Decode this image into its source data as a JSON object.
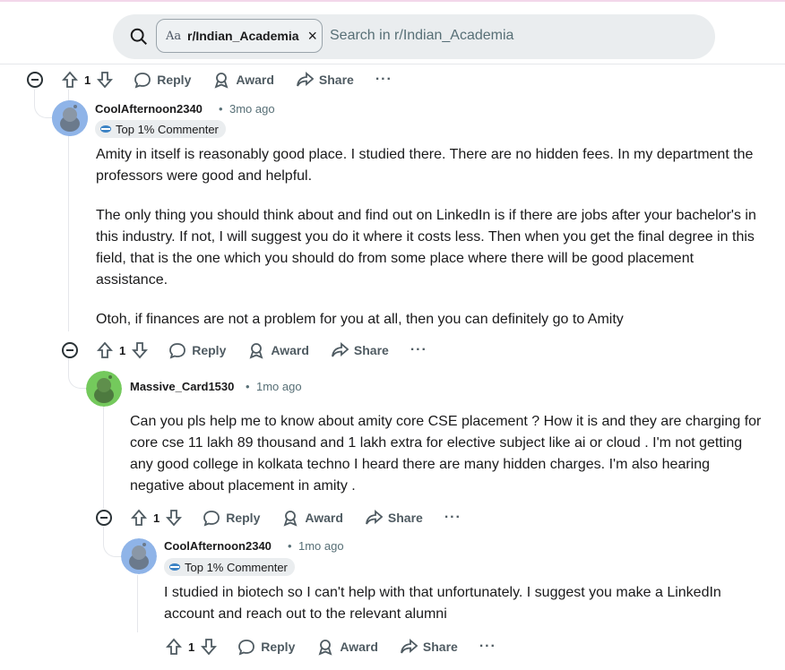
{
  "search": {
    "chip_label": "r/Indian_Academia",
    "chip_prefix": "Aa",
    "chip_close": "×",
    "placeholder": "Search in r/Indian_Academia"
  },
  "colors": {
    "upvote_brand": "#4f5b62",
    "avatar_blue": "#8fb4e8",
    "avatar_green": "#74c95c",
    "thread_line": "#e5e7eb"
  },
  "action_labels": {
    "reply": "Reply",
    "award": "Award",
    "share": "Share",
    "more": "···"
  },
  "comments": [
    {
      "votes": "1"
    },
    {
      "username": "CoolAfternoon2340",
      "time": "3mo ago",
      "badge": "Top 1% Commenter",
      "paragraphs": [
        "Amity in itself is reasonably good place. I studied there. There are no hidden fees. In my department the professors were good and helpful.",
        "The only thing you should think about and find out on LinkedIn is if there are jobs after your bachelor's in this industry. If not, I will suggest you do it where it costs less. Then when you get the final degree in this field, that is the one which you should do from some place where there will be good placement assistance.",
        "Otoh, if finances are not a problem for you at all, then you can definitely go to Amity"
      ],
      "votes": "1"
    },
    {
      "username": "Massive_Card1530",
      "time": "1mo ago",
      "paragraphs": [
        "Can you pls help me to know about amity core CSE placement ? How it is and they are charging for core cse 11 lakh 89 thousand and 1 lakh extra for elective subject like ai or cloud . I'm not getting any good college in kolkata techno I heard there are many hidden charges. I'm also hearing negative about placement in amity ."
      ],
      "votes": "1"
    },
    {
      "username": "CoolAfternoon2340",
      "time": "1mo ago",
      "badge": "Top 1% Commenter",
      "paragraphs": [
        "I studied in biotech so I can't help with that unfortunately. I suggest you make a LinkedIn account and reach out to the relevant alumni"
      ],
      "votes": "1"
    }
  ],
  "separator": "•"
}
